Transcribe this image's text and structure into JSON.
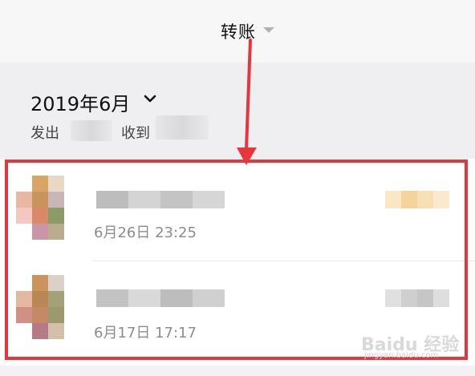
{
  "header": {
    "title": "转账"
  },
  "summary": {
    "month": "2019年6月",
    "sent_label": "发出",
    "received_label": "收到"
  },
  "transactions": [
    {
      "time": "6月26日 23:25"
    },
    {
      "time": "6月17日 17:17"
    }
  ],
  "colors": {
    "highlight": "#e8353c",
    "background": "#f2f2f4"
  },
  "watermark": {
    "text": "Baidu 经验",
    "sub": "jingyan.baidu.com"
  }
}
